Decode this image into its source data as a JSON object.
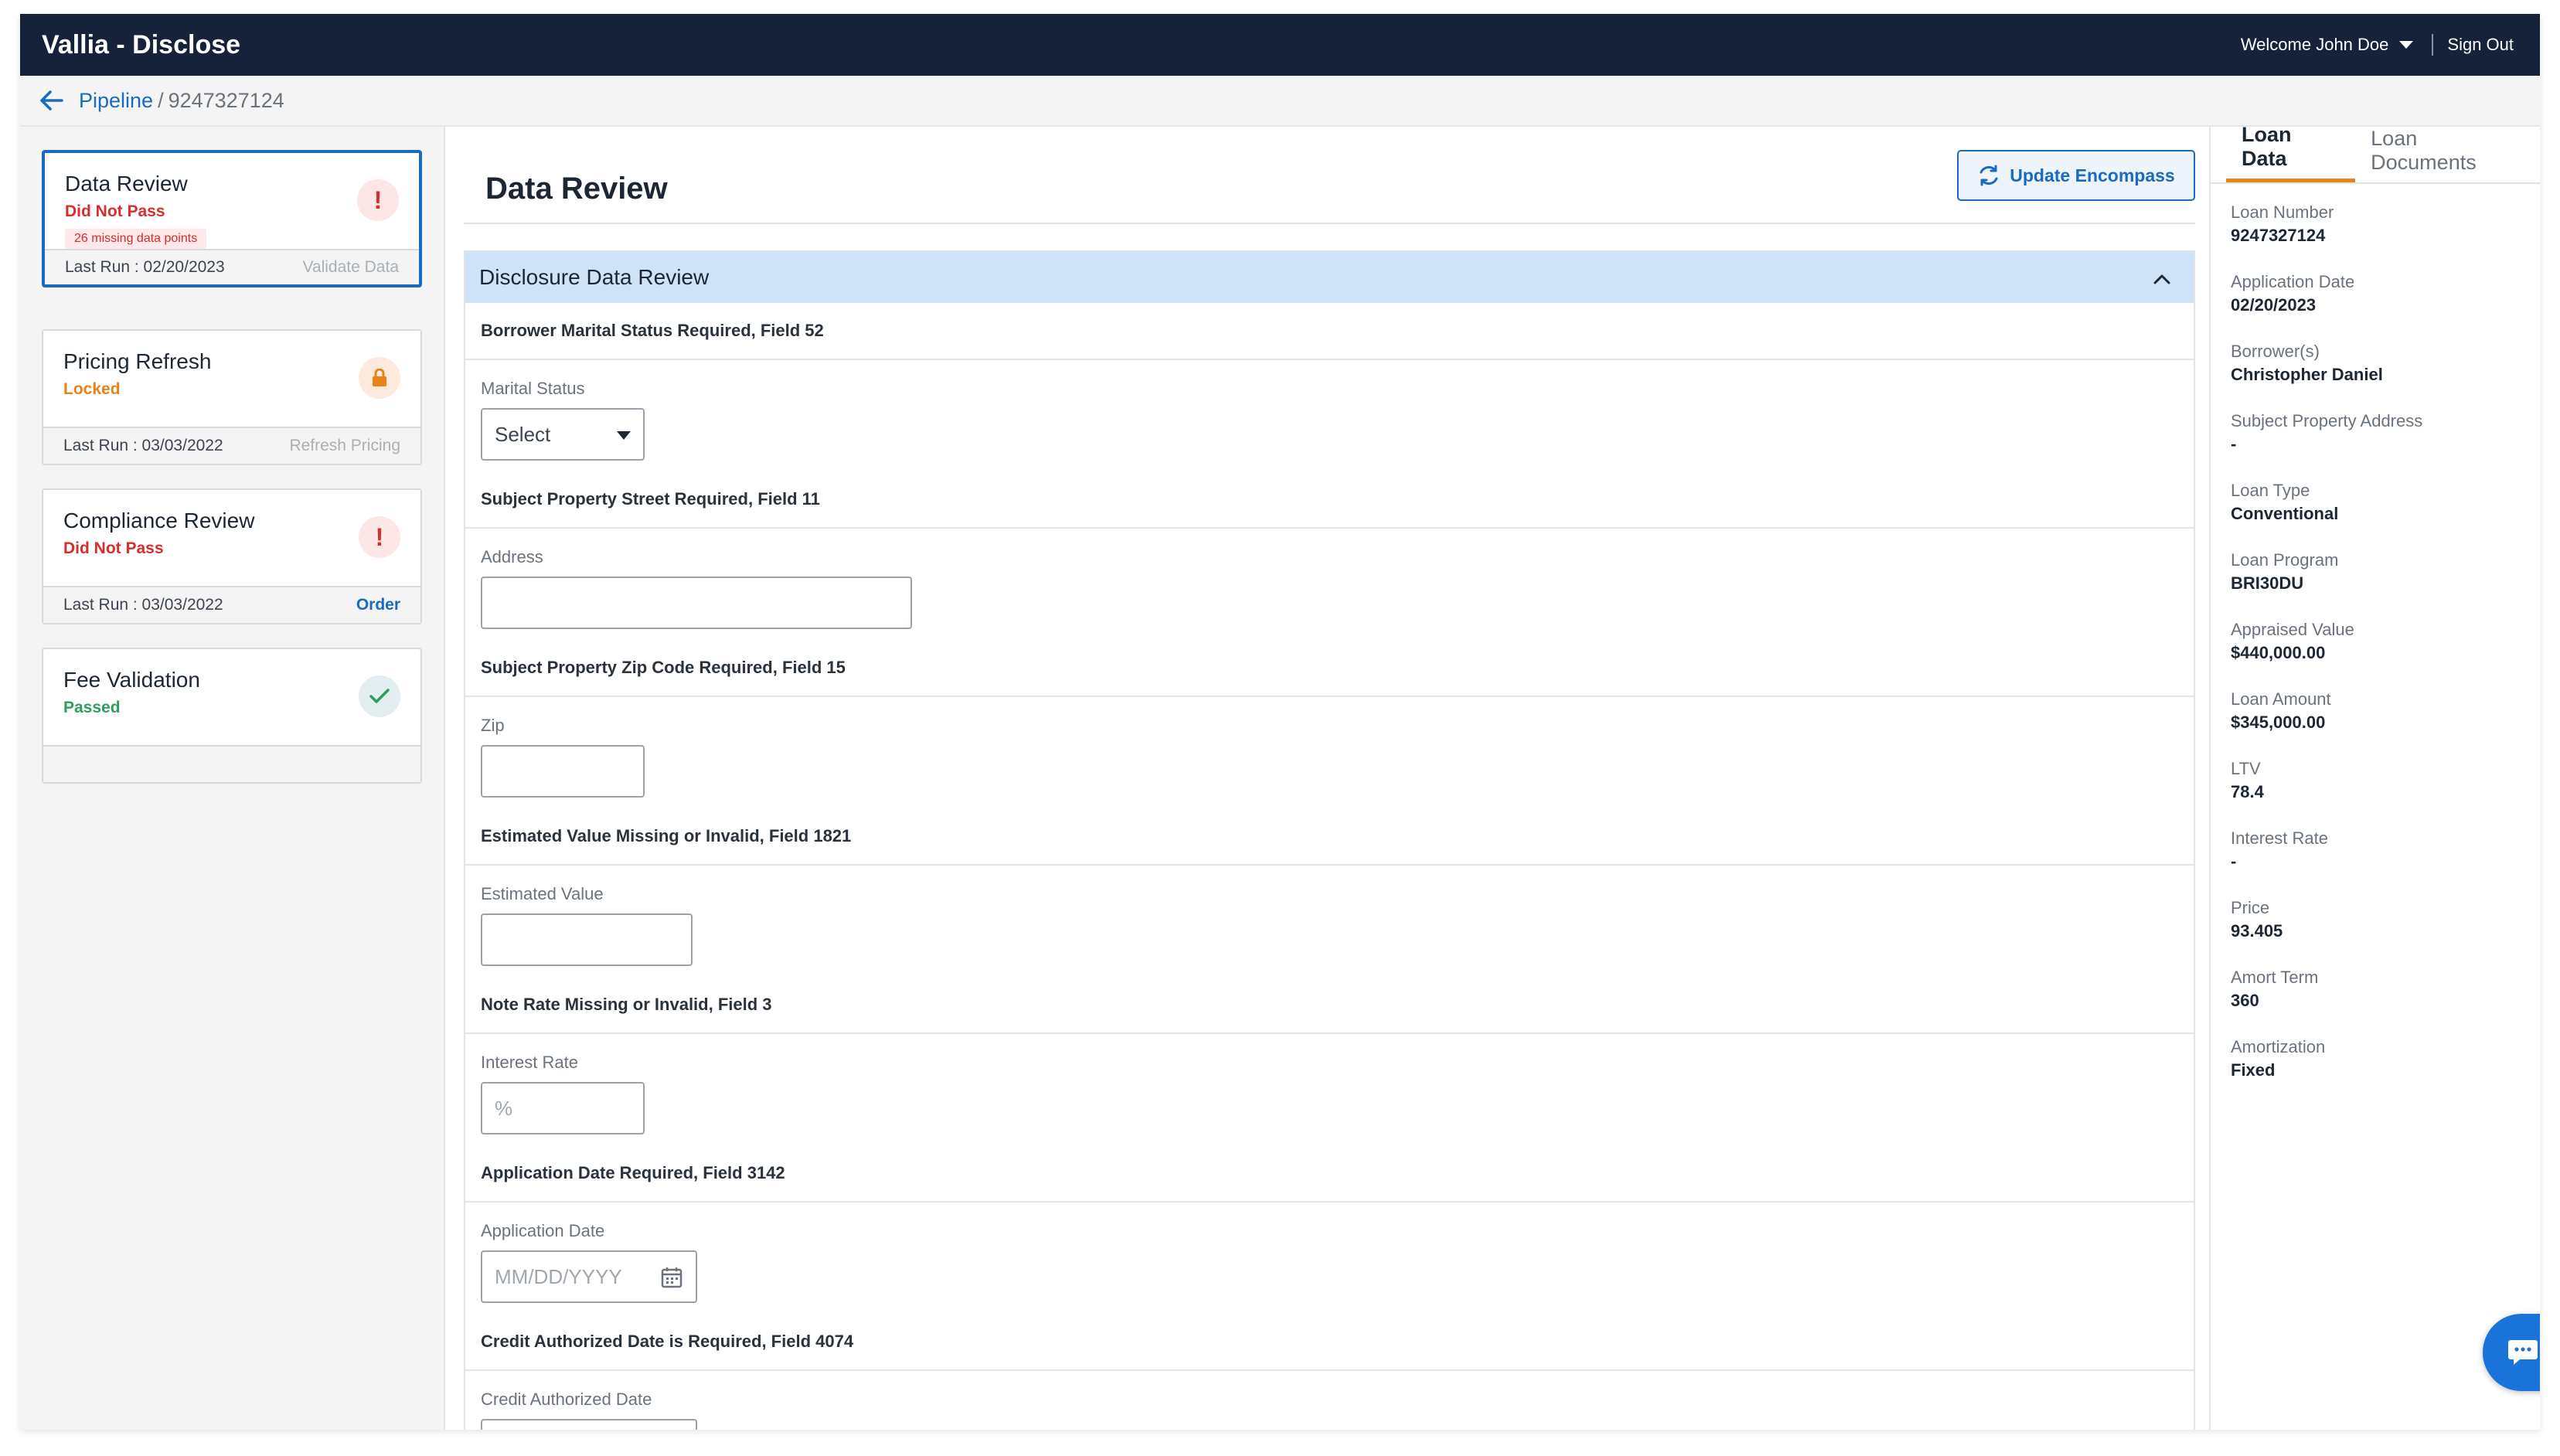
{
  "app": {
    "title": "Vallia - Disclose",
    "welcome": "Welcome John Doe",
    "sign_out": "Sign Out"
  },
  "breadcrumb": {
    "link": "Pipeline",
    "separator": "/",
    "current": "9247327124"
  },
  "steps": [
    {
      "title": "Data Review",
      "status": "Did Not Pass",
      "badge": "26 missing data points",
      "last_run": "Last Run : 02/20/2023",
      "action": "Validate Data",
      "icon": "exclamation-icon"
    },
    {
      "title": "Pricing Refresh",
      "status": "Locked",
      "last_run": "Last Run : 03/03/2022",
      "action": "Refresh Pricing",
      "icon": "lock-icon"
    },
    {
      "title": "Compliance Review",
      "status": "Did Not Pass",
      "last_run": "Last Run : 03/03/2022",
      "action": "Order",
      "icon": "exclamation-icon"
    },
    {
      "title": "Fee Validation",
      "status": "Passed",
      "icon": "check-icon"
    }
  ],
  "main": {
    "title": "Data Review",
    "update_button": "Update Encompass",
    "section_title": "Disclosure Data Review",
    "groups": [
      {
        "title": "Borrower Marital Status Required, Field 52",
        "label": "Marital Status",
        "value": "Select",
        "type": "select"
      },
      {
        "title": "Subject Property Street Required, Field 11",
        "label": "Address",
        "value": "",
        "type": "text"
      },
      {
        "title": "Subject Property Zip Code Required, Field 15",
        "label": "Zip",
        "value": "",
        "type": "text"
      },
      {
        "title": "Estimated Value Missing or Invalid, Field 1821",
        "label": "Estimated Value",
        "value": "",
        "type": "text"
      },
      {
        "title": "Note Rate Missing or Invalid, Field 3",
        "label": "Interest Rate",
        "placeholder": "%",
        "type": "text"
      },
      {
        "title": "Application Date Required, Field 3142",
        "label": "Application Date",
        "placeholder": "MM/DD/YYYY",
        "type": "date"
      },
      {
        "title": "Credit Authorized Date is Required, Field 4074",
        "label": "Credit Authorized Date",
        "type": "date"
      }
    ]
  },
  "right_panel": {
    "tabs": [
      "Loan Data",
      "Loan Documents"
    ],
    "fields": [
      {
        "label": "Loan Number",
        "value": "9247327124"
      },
      {
        "label": "Application Date",
        "value": "02/20/2023"
      },
      {
        "label": "Borrower(s)",
        "value": "Christopher Daniel"
      },
      {
        "label": "Subject Property Address",
        "value": "-"
      },
      {
        "label": "Loan Type",
        "value": "Conventional"
      },
      {
        "label": "Loan Program",
        "value": "BRI30DU"
      },
      {
        "label": "Appraised Value",
        "value": "$440,000.00"
      },
      {
        "label": "Loan Amount",
        "value": "$345,000.00"
      },
      {
        "label": "LTV",
        "value": "78.4"
      },
      {
        "label": "Interest Rate",
        "value": "-"
      },
      {
        "label": "Price",
        "value": "93.405"
      },
      {
        "label": "Amort Term",
        "value": "360"
      },
      {
        "label": "Amortization",
        "value": "Fixed"
      }
    ]
  },
  "colors": {
    "topbar": "#16223a",
    "accent": "#1a6bbf",
    "fail": "#d62d2d",
    "locked": "#e8821a",
    "pass": "#2e9e5b",
    "section_header": "#cfe3f8"
  }
}
